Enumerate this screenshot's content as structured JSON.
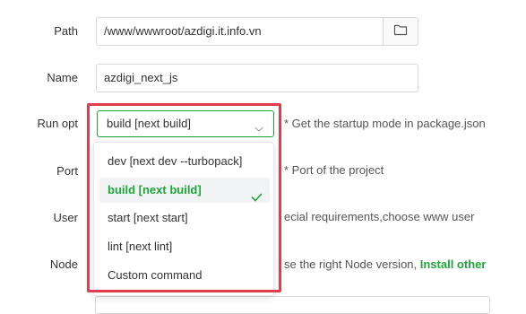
{
  "form": {
    "path": {
      "label": "Path",
      "value": "/www/wwwroot/azdigi.it.info.vn",
      "folder_icon": "folder-icon"
    },
    "name": {
      "label": "Name",
      "value": "azdigi_next_js"
    },
    "run_opt": {
      "label": "Run opt",
      "selected": "build [next build]",
      "hint": "* Get the startup mode in package.json"
    },
    "port": {
      "label": "Port",
      "hint": "* Port of the project"
    },
    "user": {
      "label": "User",
      "hint_partial": "ecial requirements,choose www user"
    },
    "node": {
      "label": "Node",
      "hint_partial": "se the right Node version, ",
      "install_link": "Install other"
    }
  },
  "dropdown": {
    "options": [
      {
        "label": "dev [next dev --turbopack]",
        "selected": false
      },
      {
        "label": "build [next build]",
        "selected": true
      },
      {
        "label": "start [next start]",
        "selected": false
      },
      {
        "label": "lint [next lint]",
        "selected": false
      },
      {
        "label": "Custom command",
        "selected": false
      }
    ]
  },
  "colors": {
    "accent": "#20a53a",
    "highlight": "#e03c4c",
    "border": "#d9d9d9"
  }
}
